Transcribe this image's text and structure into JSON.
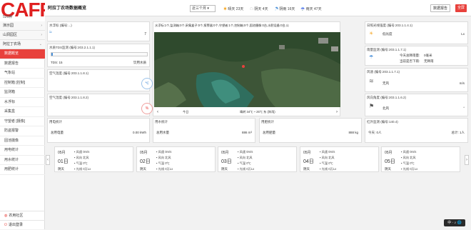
{
  "logo": {
    "text": "CAFFZ",
    "sub": "526种"
  },
  "sidebar": {
    "groups": [
      {
        "label": "演示园",
        "items": []
      },
      {
        "label": "山洞园区",
        "items": []
      },
      {
        "label": "阿拉丁农场",
        "items": [
          "数据概览",
          "数据报告",
          "气象站",
          "控制箱 [控制]",
          "监测箱",
          "水浮标",
          "采集盒",
          "守望者 [摄像]",
          "防盗报警",
          "固池摄像",
          "用电统计",
          "用水统计",
          "用肥统计"
        ]
      }
    ],
    "footer": [
      "农用社区",
      "退出登录"
    ]
  },
  "topbar": {
    "title": "阿拉丁农场数据概览",
    "select": "近三个月",
    "stats": [
      "晴天 23天",
      "阴天 4天",
      "阴雨 16天",
      "雨天 47天"
    ],
    "report_btn": "数据报告",
    "full_btn": "全屏"
  },
  "cards": {
    "water_level": {
      "title": "水浮标 (编号:...)",
      "value": "7"
    },
    "tds": {
      "title": "水质TDS监测 (编号:203.2.1.1.1)",
      "label": "TDS: 15",
      "status": "饮用水质"
    },
    "air_temp": {
      "title": "空气温度 (编号:203.1.1.8.1)",
      "value": "℃"
    },
    "air_hum": {
      "title": "空气湿度 (编号:203.1.1.8.2)",
      "value": "%"
    },
    "light": {
      "title": "日照光线强度 (编号:203.1.1.4.1)",
      "desc": "低光度",
      "unit": "Lx"
    },
    "rain": {
      "title": "雨量监测 (编号:203.1.1.7.1)",
      "l1": "今天总降雨量:",
      "v1": "0毫米",
      "l2": "当前是否下雨:",
      "v2": "无降雨"
    },
    "wind": {
      "title": "风速 (编号:203.1.1.7.1)",
      "desc": "无风",
      "unit": "m/s"
    },
    "wind_dir": {
      "title": "风向角度 (编号:203.1.1.6.2)",
      "desc": "北风",
      "unit": "°"
    },
    "power": {
      "title": "用电统计",
      "label": "总用电量",
      "value": "0.00 kWh"
    },
    "water": {
      "title": "用水统计",
      "label": "总用水量",
      "value": "886 m³"
    },
    "fert": {
      "title": "用肥统计",
      "label": "总用肥量",
      "value": "888 kg"
    },
    "ir": {
      "title": "红外监测 (编号:140.4)",
      "label": "今天: 0人",
      "total": "总计: 1人"
    }
  },
  "map": {
    "devices": "水浮标:1个,监测箱:0个,采集盒子:0个,报警器:0个,守望者:1个,控制箱:0个,固池摄像:0台,水肥设备:0台,公",
    "today": "今日",
    "weather": "晴转 34℃ ~ 25℃ 东 (阵雨)"
  },
  "forecast": [
    {
      "month": "05月",
      "day": "01日",
      "wx": "阴天",
      "speed": "0m/s",
      "dir": "北风",
      "temp": "0℃",
      "light": "0万Lx"
    },
    {
      "month": "05月",
      "day": "02日",
      "wx": "阴天",
      "speed": "0m/s",
      "dir": "北风",
      "temp": "0℃",
      "light": "0万Lx"
    },
    {
      "month": "05月",
      "day": "03日",
      "wx": "阴天",
      "speed": "0m/s",
      "dir": "北风",
      "temp": "0℃",
      "light": "0万Lx"
    },
    {
      "month": "05月",
      "day": "04日",
      "wx": "阴天",
      "speed": "0m/s",
      "dir": "北风",
      "temp": "0℃",
      "light": "0万Lx"
    },
    {
      "month": "05月",
      "day": "05日",
      "wx": "阴天",
      "speed": "0m/s",
      "dir": "北风",
      "temp": "0℃",
      "light": "0万Lx"
    }
  ],
  "forecast_labels": {
    "speed": "风速",
    "dir": "风向",
    "temp": "气温",
    "light": "光线"
  },
  "widget": "中 · ♪ 🌐"
}
